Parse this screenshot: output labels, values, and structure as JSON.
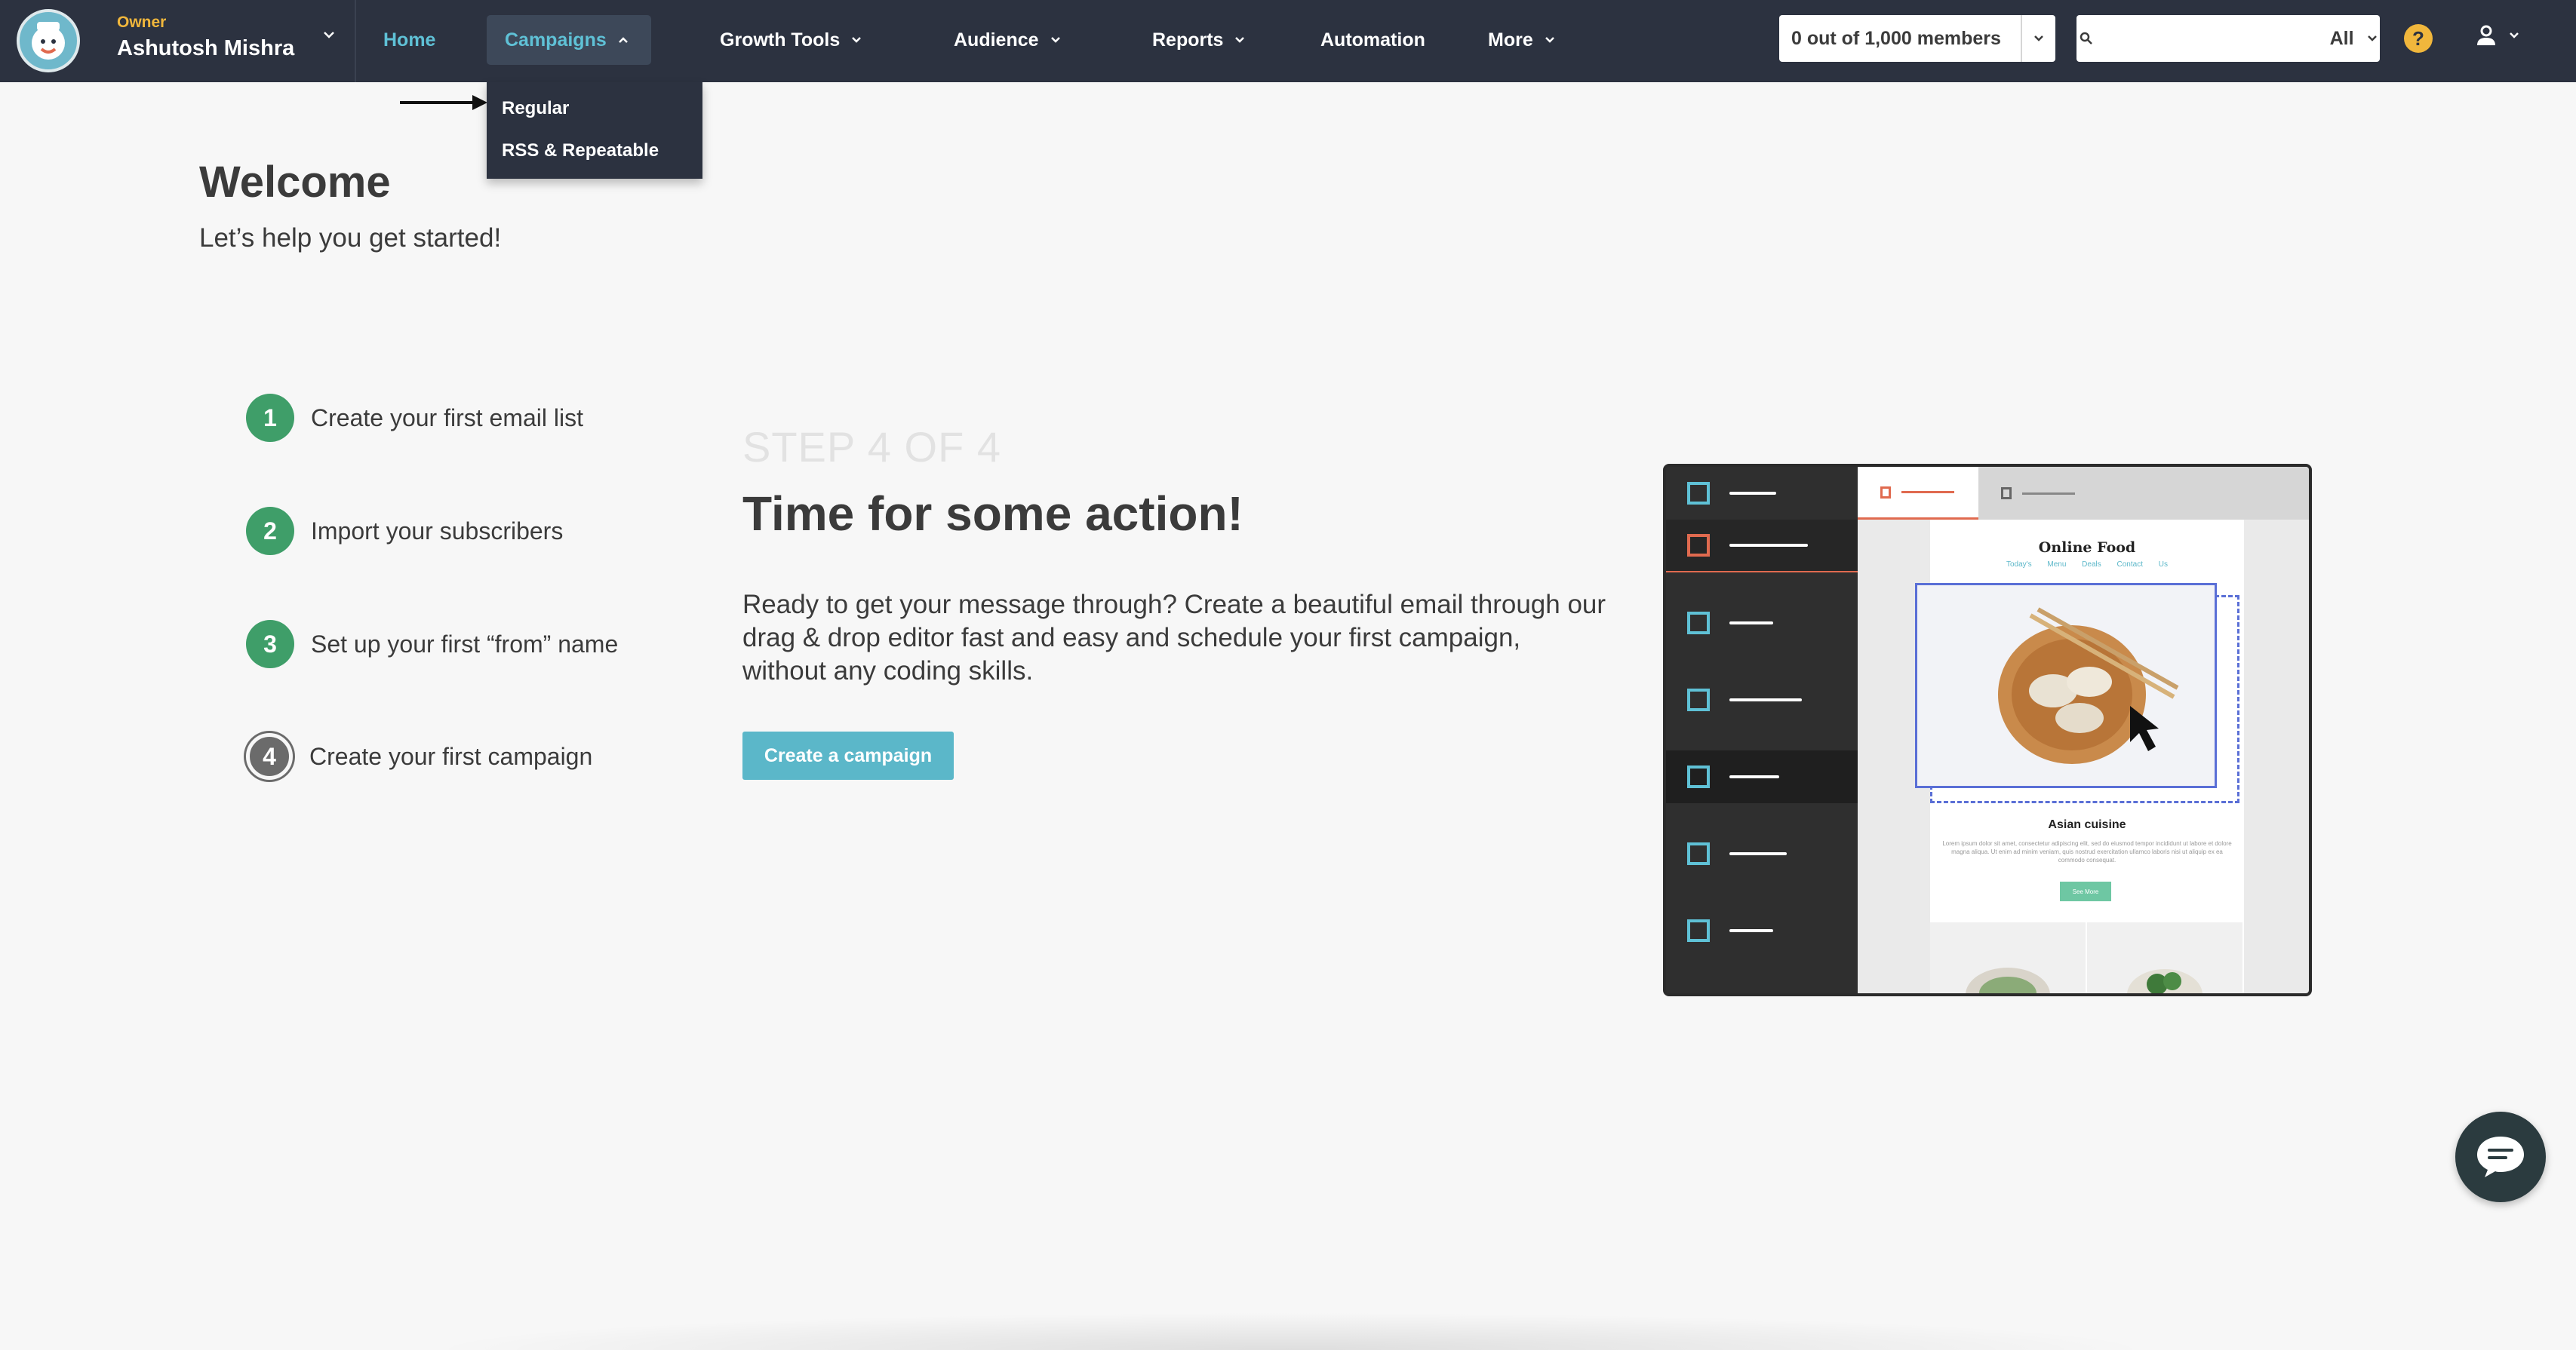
{
  "header": {
    "owner_role": "Owner",
    "owner_name": "Ashutosh Mishra",
    "nav": {
      "home": "Home",
      "campaigns": "Campaigns",
      "growth_tools": "Growth Tools",
      "audience": "Audience",
      "reports": "Reports",
      "automation": "Automation",
      "more": "More"
    },
    "members": "0 out of 1,000 members",
    "search": {
      "placeholder": "",
      "scope": "All"
    },
    "help": "?"
  },
  "campaigns_dropdown": {
    "items": [
      "Regular",
      "RSS & Repeatable"
    ]
  },
  "welcome": {
    "title": "Welcome",
    "subtitle": "Let’s help you get started!"
  },
  "steps": [
    {
      "number": "1",
      "label": "Create your first email list",
      "status": "done"
    },
    {
      "number": "2",
      "label": "Import your subscribers",
      "status": "done"
    },
    {
      "number": "3",
      "label": "Set up your first “from” name",
      "status": "done"
    },
    {
      "number": "4",
      "label": "Create your first campaign",
      "status": "current"
    }
  ],
  "main": {
    "step_counter": "STEP 4 OF 4",
    "title": "Time for some action!",
    "description": "Ready to get your message through? Create a beautiful email through our drag & drop editor fast and easy and schedule your first campaign, without any coding skills.",
    "cta_label": "Create a campaign"
  },
  "illustration": {
    "brand": "Online Food",
    "links": "Today's Menu Deals Contact Us",
    "section_title": "Asian cuisine",
    "body_text": "Lorem ipsum dolor sit amet, consectetur adipiscing elit, sed do eiusmod tempor incididunt ut labore et dolore magna aliqua. Ut enim ad minim veniam, quis nostrud exercitation ullamco laboris nisi ut aliquip ex ea commodo consequat.",
    "button": "See More"
  },
  "colors": {
    "navbar": "#2c3240",
    "accent": "#5fc1d6",
    "step_done": "#3f9e69",
    "step_current": "#6b6b6b",
    "cta": "#5bb7c9",
    "owner_role": "#f1b73c"
  }
}
